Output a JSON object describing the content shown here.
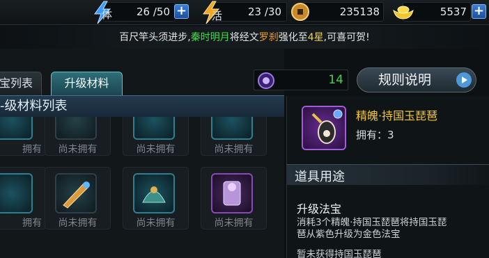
{
  "resources": {
    "stamina": {
      "icon": "stamina-lightning-icon",
      "label": "体",
      "value": "26 /50"
    },
    "vigor": {
      "icon": "vigor-lightning-icon",
      "label": "活",
      "value": "23 /30"
    },
    "coins": {
      "icon": "copper-coin-icon",
      "value": "235138"
    },
    "gold": {
      "icon": "gold-ingot-icon",
      "value": "5537"
    }
  },
  "notice": {
    "prefix": "百尺竿头须进步,",
    "player": "秦时明月",
    "mid": "将经文",
    "item": "罗刹",
    "mid2": "强化至",
    "level": "4星",
    "suffix": ",可喜可贺!"
  },
  "tabs": [
    {
      "label": "宝列表",
      "active": false
    },
    {
      "label": "升级材料",
      "active": true
    }
  ],
  "list_header": "-级材料列表",
  "grid_caption": "尚未拥有",
  "grid_rows": [
    [
      "拥有",
      "尚未拥有",
      "尚未拥有",
      "尚未拥有"
    ],
    [
      "拥有",
      "尚未拥有",
      "尚未拥有",
      "尚未拥有"
    ]
  ],
  "essence_count": "14",
  "rules_button": "规则说明",
  "item": {
    "name": "精魄·持国玉琵琶",
    "owned": "拥有：3"
  },
  "usage": {
    "header": "道具用途",
    "title": "升级法宝",
    "desc": "消耗3个精魄·持国玉琵琶将持国玉琵琶从紫色升级为金色法宝",
    "status": "暂未获得持国玉琵琶"
  },
  "colors": {
    "accent_green": "#3ee04a",
    "accent_orange": "#f0a02a",
    "accent_yellow": "#f3d23a",
    "item_name": "#f2c734",
    "essence_value": "#3fd84a"
  }
}
